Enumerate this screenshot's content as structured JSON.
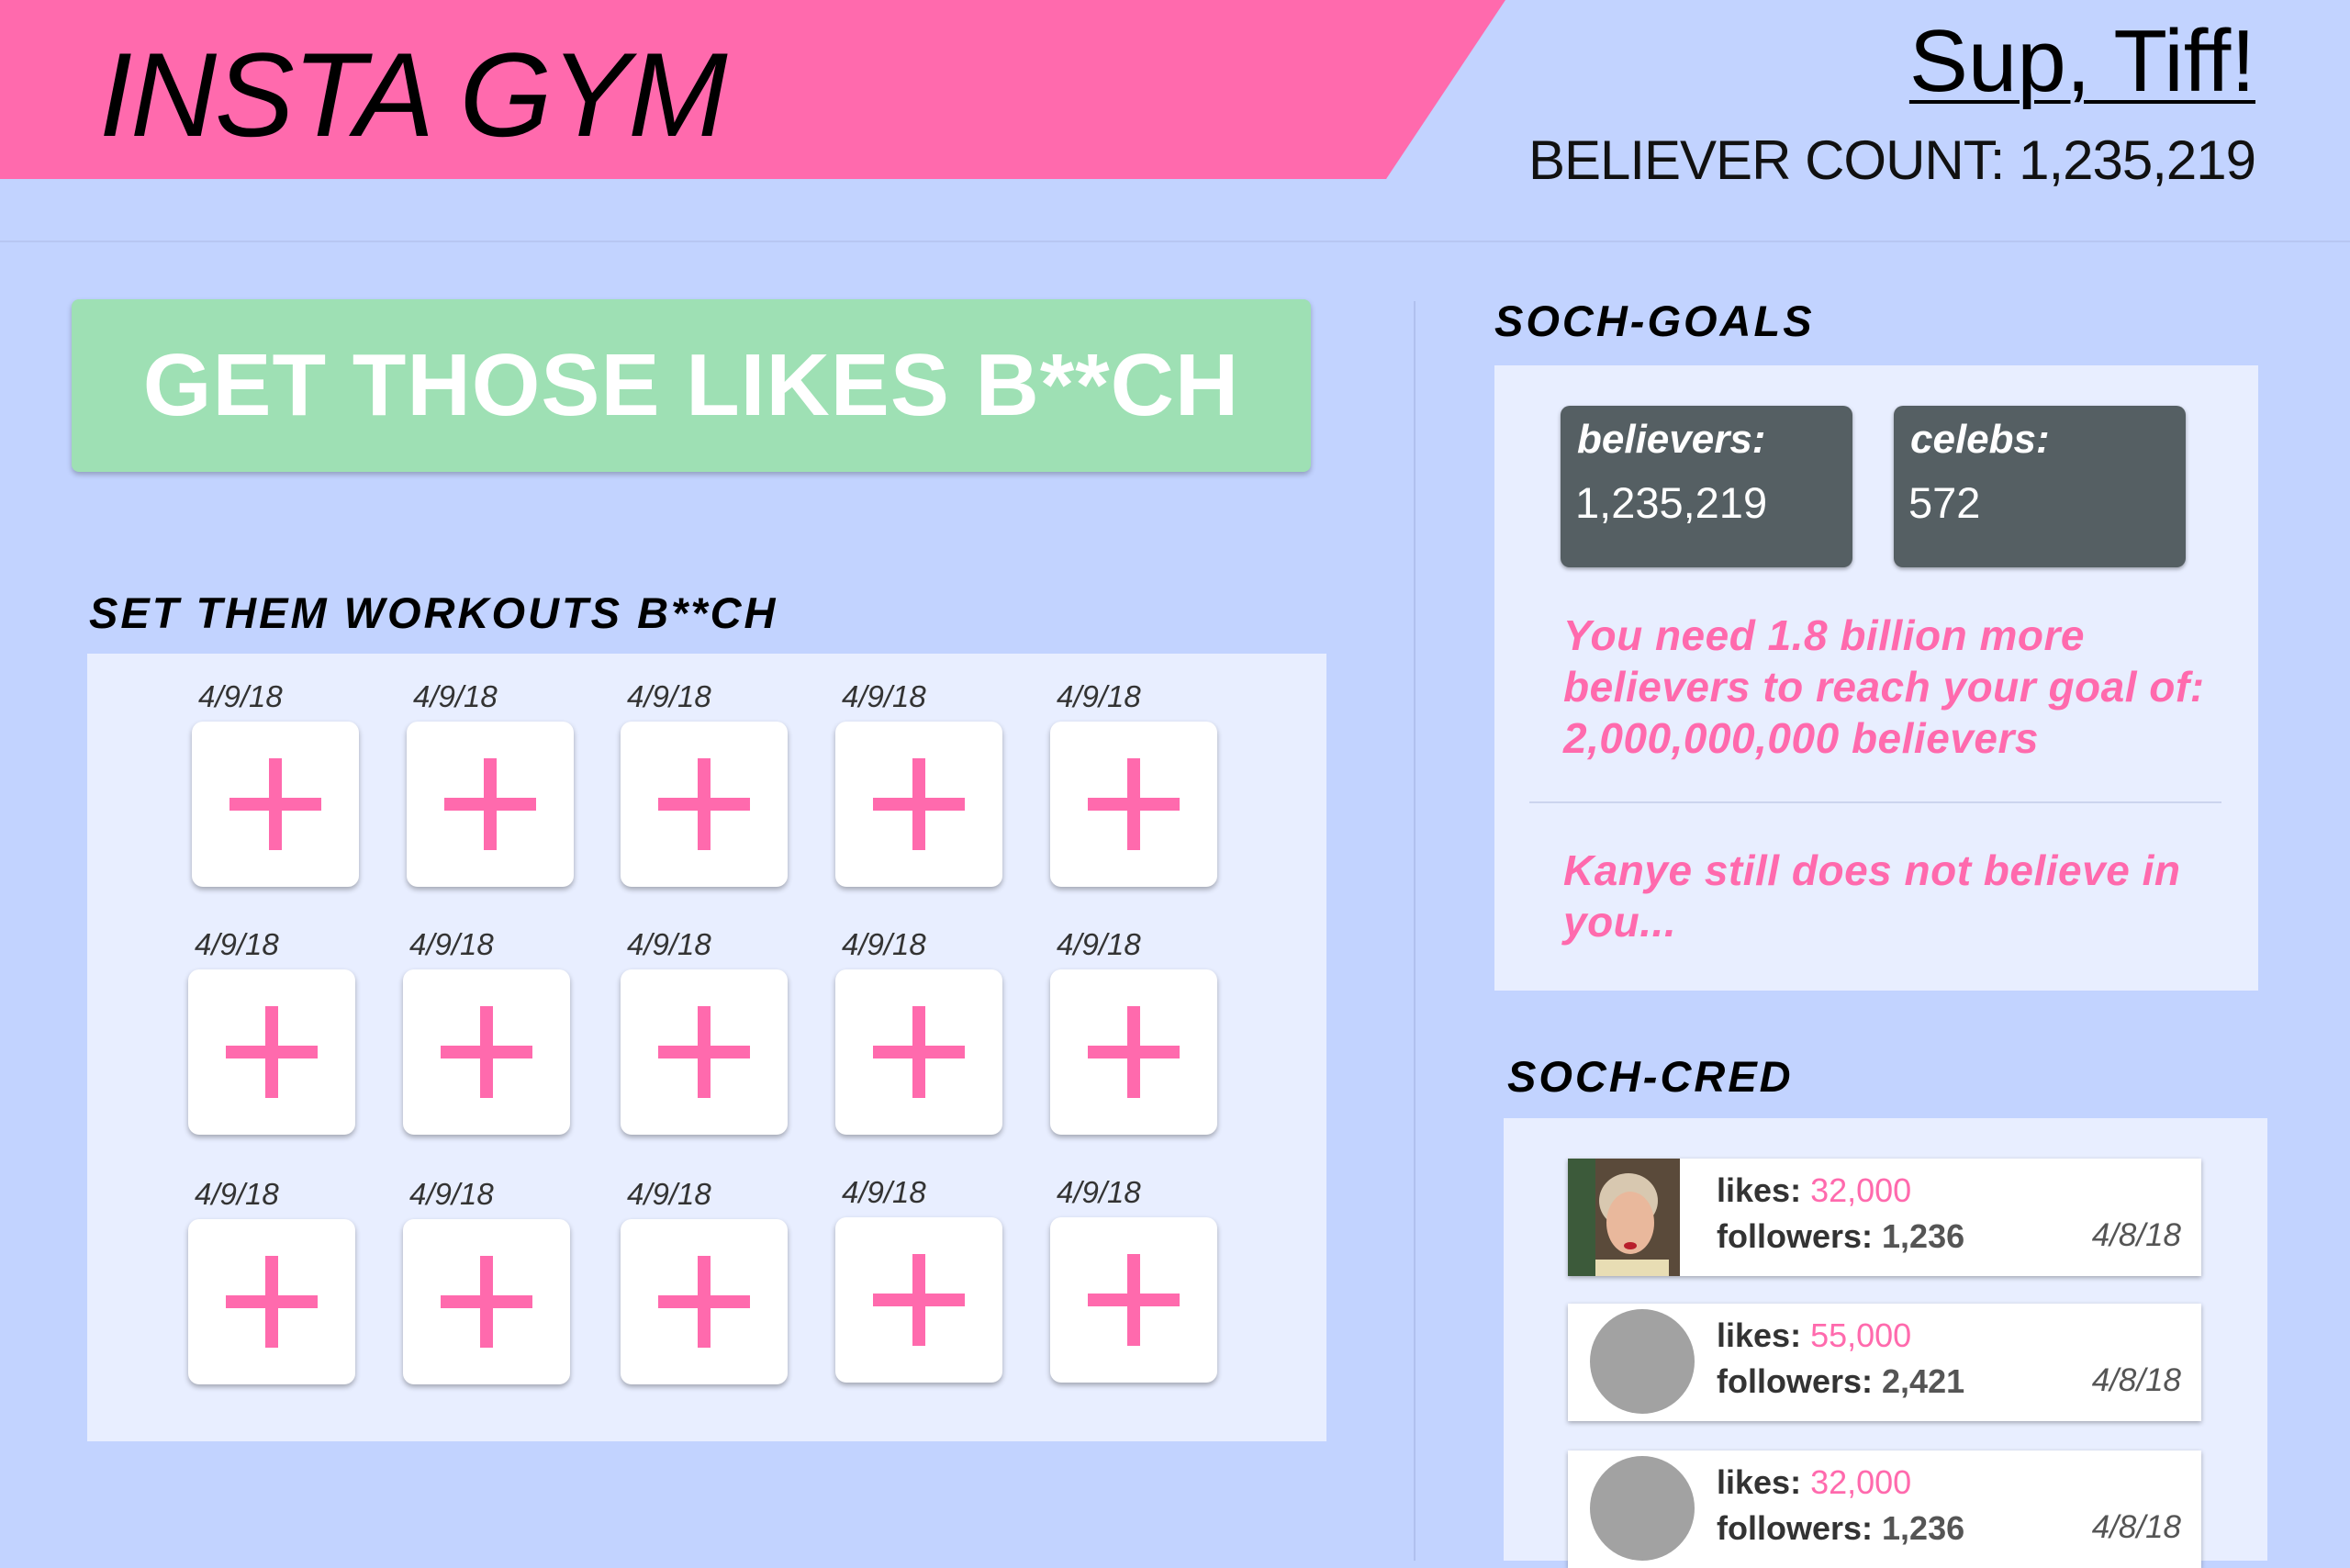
{
  "header": {
    "title": "INSTA GYM",
    "greeting": "Sup, Tiff!",
    "believer_count": "BELIEVER COUNT: 1,235,219"
  },
  "main": {
    "likes_button": "GET THOSE LIKES B**CH",
    "workouts_heading": "SET THEM  WORKOUTS B**CH",
    "workouts": [
      [
        {
          "date": "4/9/18"
        },
        {
          "date": "4/9/18"
        },
        {
          "date": "4/9/18"
        },
        {
          "date": "4/9/18"
        },
        {
          "date": "4/9/18"
        }
      ],
      [
        {
          "date": "4/9/18"
        },
        {
          "date": "4/9/18"
        },
        {
          "date": "4/9/18"
        },
        {
          "date": "4/9/18"
        },
        {
          "date": "4/9/18"
        }
      ],
      [
        {
          "date": "4/9/18"
        },
        {
          "date": "4/9/18"
        },
        {
          "date": "4/9/18"
        },
        {
          "date": "4/9/18"
        },
        {
          "date": "4/9/18"
        }
      ]
    ]
  },
  "goals": {
    "heading": "SOCH-GOALS",
    "believers_label": "believers:",
    "believers_value": "1,235,219",
    "celebs_label": "celebs:",
    "celebs_value": "572",
    "goal_message": "You need 1.8 billion more believers to reach your goal of: 2,000,000,000 believers",
    "kanye_message": "Kanye still does not believe in you..."
  },
  "cred": {
    "heading": "SOCH-CRED",
    "likes_label": "likes:",
    "followers_label": "followers:",
    "posts": [
      {
        "likes": "32,000",
        "followers": "1,236",
        "date": "4/8/18",
        "avatar": "photo"
      },
      {
        "likes": "55,000",
        "followers": "2,421",
        "date": "4/8/18",
        "avatar": "placeholder"
      },
      {
        "likes": "32,000",
        "followers": "1,236",
        "date": "4/8/18",
        "avatar": "placeholder"
      }
    ]
  },
  "colors": {
    "accent_pink": "#ff6aad",
    "background": "#c2d3ff",
    "button_green": "#9ee0b4",
    "card_dark": "#555f63"
  }
}
